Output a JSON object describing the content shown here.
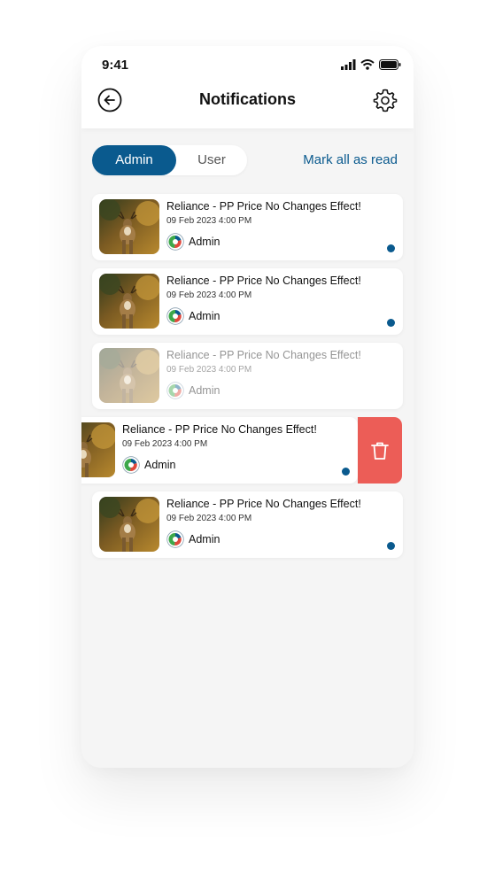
{
  "status_bar": {
    "time": "9:41"
  },
  "header": {
    "title": "Notifications"
  },
  "tabs": {
    "admin": "Admin",
    "user": "User",
    "active": "Admin"
  },
  "actions": {
    "mark_all": "Mark all as read"
  },
  "notifications": [
    {
      "title": "Reliance - PP Price No Changes Effect!",
      "time": "09 Feb 2023 4:00 PM",
      "sender": "Admin",
      "unread": true
    },
    {
      "title": "Reliance - PP Price No Changes Effect!",
      "time": "09 Feb 2023 4:00 PM",
      "sender": "Admin",
      "unread": true
    },
    {
      "title": "Reliance - PP Price No Changes Effect!",
      "time": "09 Feb 2023 4:00 PM",
      "sender": "Admin",
      "unread": false
    },
    {
      "title": "Reliance - PP Price No Changes Effect!",
      "time": "09 Feb 2023 4:00 PM",
      "sender": "Admin",
      "unread": true
    },
    {
      "title": "Reliance - PP Price No Changes Effect!",
      "time": "09 Feb 2023 4:00 PM",
      "sender": "Admin",
      "unread": true
    }
  ],
  "colors": {
    "accent": "#0a5a8e",
    "delete": "#ec5d57",
    "unread_dot": "#0a5a8e",
    "background": "#f5f5f5"
  },
  "icons": {
    "back": "arrow-left-circle-icon",
    "settings": "gear-icon",
    "delete": "trash-icon",
    "sender_logo": "reliance-logo-icon"
  }
}
